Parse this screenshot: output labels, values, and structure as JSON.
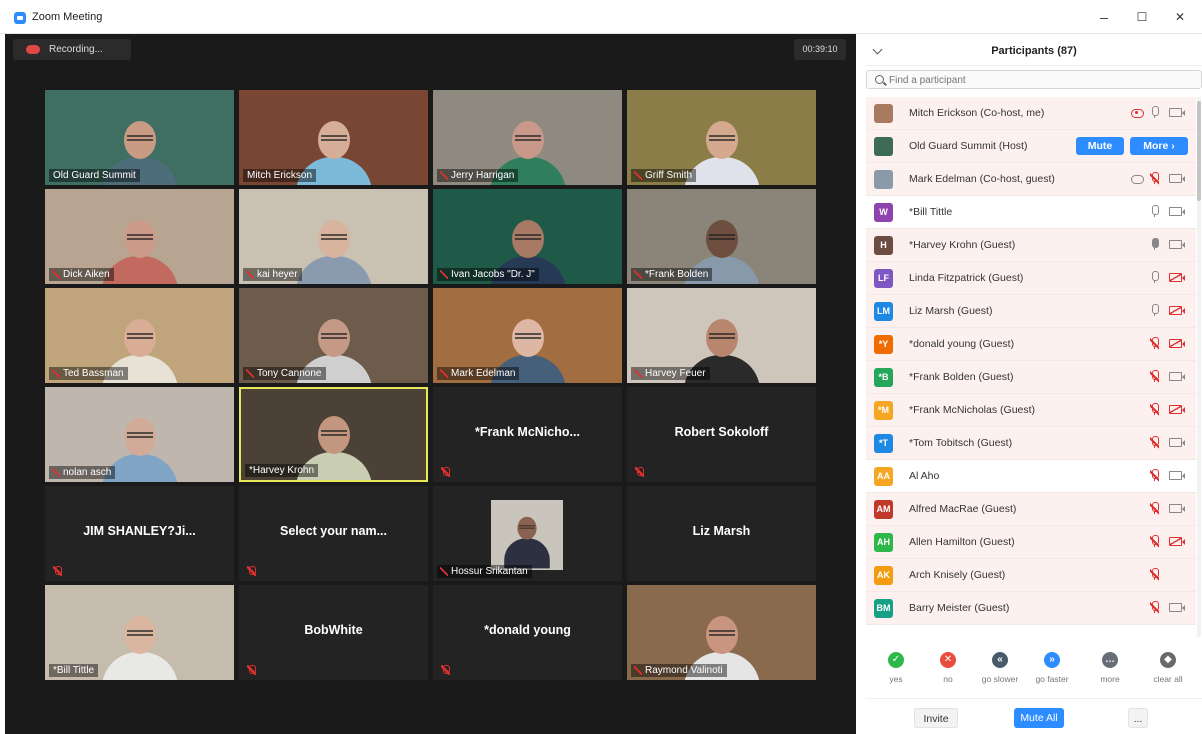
{
  "window": {
    "title": "Zoom Meeting",
    "controls": {
      "minimize": "–",
      "maximize": "☐",
      "close": "✕"
    }
  },
  "meeting": {
    "recording_label": "Recording...",
    "timer": "00:39:10",
    "tiles": [
      {
        "name": "Old Guard Summit",
        "video": true,
        "muted": false,
        "bg": "#3f6f63",
        "skin": "#c99b82",
        "shirt": "#4d6d7a"
      },
      {
        "name": "Mitch Erickson",
        "video": true,
        "muted": false,
        "bg": "#7a4634",
        "skin": "#d6ae98",
        "shirt": "#7db9d8"
      },
      {
        "name": "Jerry Harrigan",
        "video": true,
        "muted": true,
        "bg": "#8e8a7f",
        "skin": "#c8998a",
        "shirt": "#2f7f5d"
      },
      {
        "name": "Griff Smith",
        "video": true,
        "muted": true,
        "bg": "#8a7d48",
        "skin": "#d5a98f",
        "shirt": "#dfe2ea"
      },
      {
        "name": "Dick Aiken",
        "video": true,
        "muted": true,
        "bg": "#b7a591",
        "skin": "#cc9a88",
        "shirt": "#c26a60"
      },
      {
        "name": "kai heyer",
        "video": true,
        "muted": true,
        "bg": "#c9c1b2",
        "skin": "#d8b39e",
        "shirt": "#8a9bb0"
      },
      {
        "name": "Ivan Jacobs \"Dr. J\"",
        "video": true,
        "muted": true,
        "bg": "#1f5a48",
        "skin": "#a87a66",
        "shirt": "#263a56"
      },
      {
        "name": "*Frank Bolden",
        "video": true,
        "muted": true,
        "bg": "#8b8478",
        "skin": "#6e4e3f",
        "shirt": "#8899a9"
      },
      {
        "name": "Ted Bassman",
        "video": true,
        "muted": true,
        "bg": "#c0a57c",
        "skin": "#d9ad95",
        "shirt": "#e7e1d6"
      },
      {
        "name": "Tony Cannone",
        "video": true,
        "muted": true,
        "bg": "#6d5c4c",
        "skin": "#c49985",
        "shirt": "#cfcfcf"
      },
      {
        "name": "Mark Edelman",
        "video": true,
        "muted": true,
        "bg": "#a26d41",
        "skin": "#ddb7a3",
        "shirt": "#46607a"
      },
      {
        "name": "Harvey Feuer",
        "video": true,
        "muted": true,
        "bg": "#cfc6bb",
        "skin": "#b8856f",
        "shirt": "#2a2a2a"
      },
      {
        "name": "nolan asch",
        "video": true,
        "muted": true,
        "bg": "#bfb6ad",
        "skin": "#d2ab98",
        "shirt": "#7fa4c4"
      },
      {
        "name": "*Harvey Krohn",
        "video": true,
        "muted": false,
        "active": true,
        "bg": "#4c4137",
        "skin": "#c39680",
        "shirt": "#c9cdb2"
      },
      {
        "name": "*Frank  McNicho...",
        "video": false,
        "muted": true
      },
      {
        "name": "Robert Sokoloff",
        "video": false,
        "muted": true
      },
      {
        "name": "JIM SHANLEY?Ji...",
        "video": false,
        "muted": true
      },
      {
        "name": "Select your nam...",
        "video": false,
        "muted": true
      },
      {
        "name": "Hossur Srikantan",
        "video": true,
        "muted": true,
        "small": true,
        "bg": "#232323",
        "skin": "#8a6250",
        "shirt": "#2c3040"
      },
      {
        "name": "Liz Marsh",
        "video": false,
        "muted": false
      },
      {
        "name": "*Bill Tittle",
        "video": true,
        "muted": false,
        "bg": "#c6bcae",
        "skin": "#dab59f",
        "shirt": "#e8e8e6"
      },
      {
        "name": "BobWhite",
        "video": false,
        "muted": true
      },
      {
        "name": "*donald young",
        "video": false,
        "muted": true
      },
      {
        "name": "Raymond Valinoti",
        "video": true,
        "muted": true,
        "bg": "#8a6a4d",
        "skin": "#c99580",
        "shirt": "#e5e5e5"
      }
    ]
  },
  "participants": {
    "title": "Participants (87)",
    "search_placeholder": "Find a participant",
    "mute_label": "Mute",
    "more_label": "More ›",
    "list": [
      {
        "name": "Mitch Erickson (Co-host, me)",
        "avatar_text": "",
        "avatar_color": "#a87a60",
        "rec": "on",
        "mic": "plain",
        "cam": "on",
        "pink": true
      },
      {
        "name": "Old Guard Summit (Host)",
        "avatar_text": "",
        "avatar_color": "#3e6b55",
        "buttons": true,
        "pink": true
      },
      {
        "name": "Mark Edelman (Co-host, guest)",
        "avatar_text": "",
        "avatar_color": "#8a9aa8",
        "rec": "plain",
        "mic": "muted",
        "cam": "on",
        "pink": true
      },
      {
        "name": "*Bill Tittle",
        "avatar_text": "W",
        "avatar_color": "#8e44ad",
        "mic": "plain",
        "cam": "on",
        "pink": false
      },
      {
        "name": "*Harvey Krohn (Guest)",
        "avatar_text": "H",
        "avatar_color": "#6d4c41",
        "mic": "on",
        "cam": "on",
        "pink": true
      },
      {
        "name": "Linda Fitzpatrick (Guest)",
        "avatar_text": "LF",
        "avatar_color": "#7e57c2",
        "mic": "plain",
        "cam": "off",
        "pink": true
      },
      {
        "name": "Liz Marsh (Guest)",
        "avatar_text": "LM",
        "avatar_color": "#1e88e5",
        "mic": "plain",
        "cam": "off",
        "pink": true
      },
      {
        "name": "*donald young (Guest)",
        "avatar_text": "*Y",
        "avatar_color": "#ef6c00",
        "mic": "muted",
        "cam": "off",
        "pink": true
      },
      {
        "name": "*Frank Bolden (Guest)",
        "avatar_text": "*B",
        "avatar_color": "#26a65b",
        "mic": "muted",
        "cam": "on",
        "pink": true
      },
      {
        "name": "*Frank McNicholas (Guest)",
        "avatar_text": "*M",
        "avatar_color": "#f5a623",
        "mic": "muted",
        "cam": "off",
        "pink": true
      },
      {
        "name": "*Tom Tobitsch (Guest)",
        "avatar_text": "*T",
        "avatar_color": "#1e88e5",
        "mic": "muted",
        "cam": "on",
        "pink": true
      },
      {
        "name": "Al Aho",
        "avatar_text": "AA",
        "avatar_color": "#f5a623",
        "mic": "muted",
        "cam": "on",
        "pink": false
      },
      {
        "name": "Alfred MacRae (Guest)",
        "avatar_text": "AM",
        "avatar_color": "#c0392b",
        "mic": "muted",
        "cam": "on",
        "pink": true
      },
      {
        "name": "Allen Hamilton (Guest)",
        "avatar_text": "AH",
        "avatar_color": "#2eb84b",
        "mic": "muted",
        "cam": "off",
        "pink": true
      },
      {
        "name": "Arch Knisely (Guest)",
        "avatar_text": "AK",
        "avatar_color": "#f39c12",
        "mic": "muted",
        "cam": "none",
        "pink": true
      },
      {
        "name": "Barry Meister (Guest)",
        "avatar_text": "BM",
        "avatar_color": "#16a085",
        "mic": "muted",
        "cam": "on",
        "pink": true
      }
    ],
    "reactions": [
      {
        "label": "yes",
        "glyph": "✓",
        "color": "#2eb84b"
      },
      {
        "label": "no",
        "glyph": "✕",
        "color": "#e74c3c"
      },
      {
        "label": "go slower",
        "glyph": "«",
        "color": "#4a5a6a"
      },
      {
        "label": "go faster",
        "glyph": "»",
        "color": "#2d8cff"
      },
      {
        "label": "more",
        "glyph": "…",
        "color": "#666e78"
      },
      {
        "label": "clear all",
        "glyph": "◆",
        "color": "#6a6a6a"
      }
    ],
    "footer": {
      "invite": "Invite",
      "mute_all": "Mute All",
      "more": "..."
    }
  }
}
